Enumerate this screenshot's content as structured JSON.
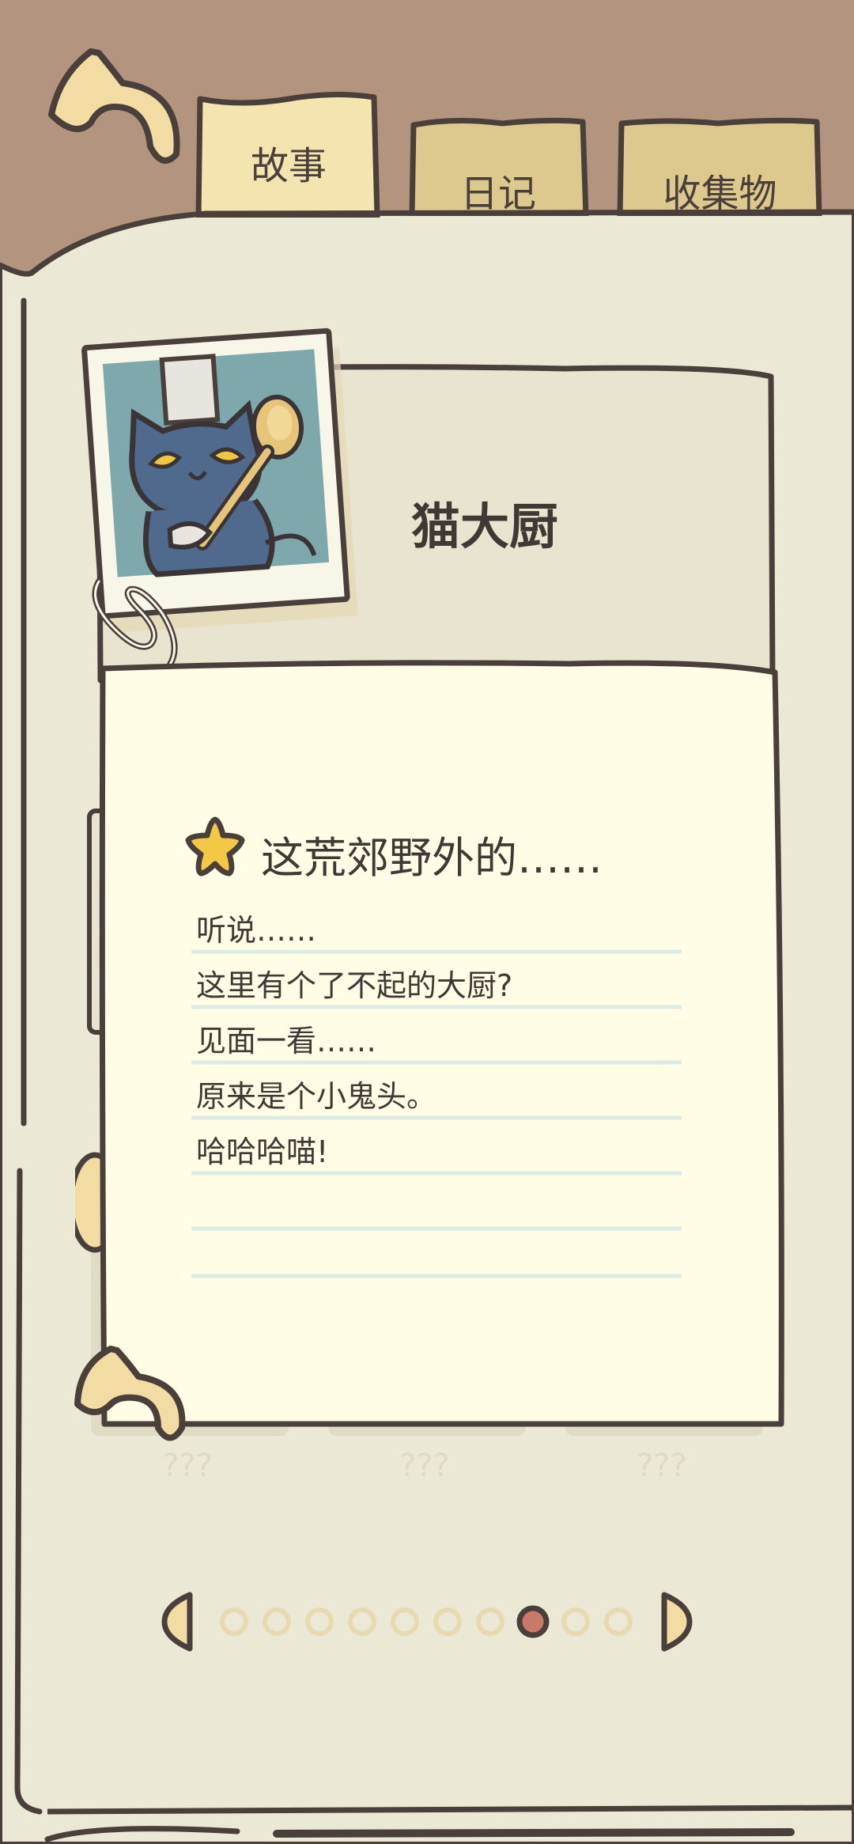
{
  "tabs": [
    {
      "label": "故事",
      "active": true
    },
    {
      "label": "日记",
      "active": false
    },
    {
      "label": "收集物",
      "active": false
    }
  ],
  "entry": {
    "title": "猫大厨"
  },
  "note": {
    "heading": "这荒郊野外的……",
    "lines": [
      "听说……",
      "这里有个了不起的大厨?",
      "见面一看……",
      "原来是个小鬼头。",
      "哈哈哈喵!"
    ]
  },
  "hidden_entries": [
    "???",
    "???",
    "???"
  ],
  "pagination": {
    "total_pages": 10,
    "current_page": 8
  },
  "colors": {
    "background_top": "#b3947f",
    "book_page": "#ebe8d5",
    "note_paper": "#fffde6",
    "tab_active": "#f3e4b0",
    "tab_inactive": "#ddc98e",
    "outline": "#4a3f3b",
    "accent_yellow": "#f5dba0",
    "dot_active": "#c9786a",
    "rule_line": "#dcebe6",
    "photo_bg": "#7fa8ad",
    "cat_body": "#4f6a8c",
    "cat_eye": "#f0c640",
    "spoon": "#e6c47a"
  },
  "icons": [
    "back-arrow-icon",
    "star-icon",
    "paperclip-icon",
    "curl-arrow-icon",
    "prev-page-icon",
    "next-page-icon"
  ]
}
